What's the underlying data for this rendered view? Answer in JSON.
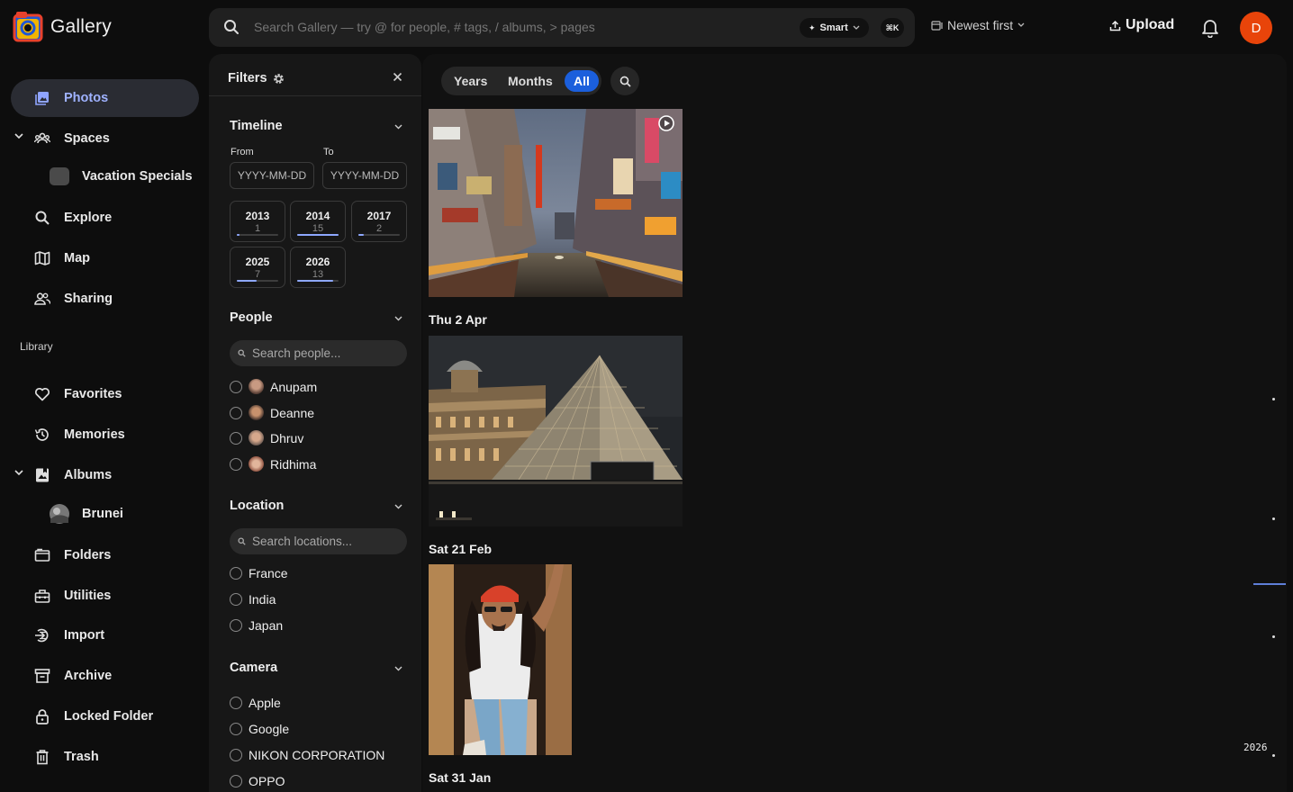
{
  "app": {
    "name": "Gallery"
  },
  "search": {
    "placeholder": "Search Gallery — try @ for people, # tags, / albums, > pages",
    "smart_label": "Smart",
    "shortcut": "⌘K"
  },
  "sort": {
    "label": "Newest first"
  },
  "upload": {
    "label": "Upload"
  },
  "user": {
    "initial": "D"
  },
  "sidebar": {
    "photos": "Photos",
    "spaces": "Spaces",
    "vacation": "Vacation Specials",
    "explore": "Explore",
    "map": "Map",
    "sharing": "Sharing",
    "library": "Library",
    "favorites": "Favorites",
    "memories": "Memories",
    "albums": "Albums",
    "brunei": "Brunei",
    "folders": "Folders",
    "utilities": "Utilities",
    "import": "Import",
    "archive": "Archive",
    "locked": "Locked Folder",
    "trash": "Trash"
  },
  "filters": {
    "title": "Filters",
    "timeline": {
      "title": "Timeline",
      "from_label": "From",
      "to_label": "To",
      "from_placeholder": "YYYY-MM-DD",
      "to_placeholder": "YYYY-MM-DD",
      "years": [
        {
          "year": "2013",
          "count": "1",
          "fraction": 0.07
        },
        {
          "year": "2014",
          "count": "15",
          "fraction": 1.0
        },
        {
          "year": "2017",
          "count": "2",
          "fraction": 0.13
        },
        {
          "year": "2025",
          "count": "7",
          "fraction": 0.47
        },
        {
          "year": "2026",
          "count": "13",
          "fraction": 0.87
        }
      ]
    },
    "people": {
      "title": "People",
      "placeholder": "Search people...",
      "items": [
        "Anupam",
        "Deanne",
        "Dhruv",
        "Ridhima"
      ]
    },
    "location": {
      "title": "Location",
      "placeholder": "Search locations...",
      "items": [
        "France",
        "India",
        "Japan"
      ]
    },
    "camera": {
      "title": "Camera",
      "items": [
        "Apple",
        "Google",
        "NIKON CORPORATION",
        "OPPO"
      ]
    }
  },
  "view": {
    "years": "Years",
    "months": "Months",
    "all": "All"
  },
  "photos": {
    "dates": [
      "Thu 2 Apr",
      "Sat 21 Feb",
      "Sat 31 Jan"
    ]
  },
  "scrubber": {
    "year": "2026"
  }
}
